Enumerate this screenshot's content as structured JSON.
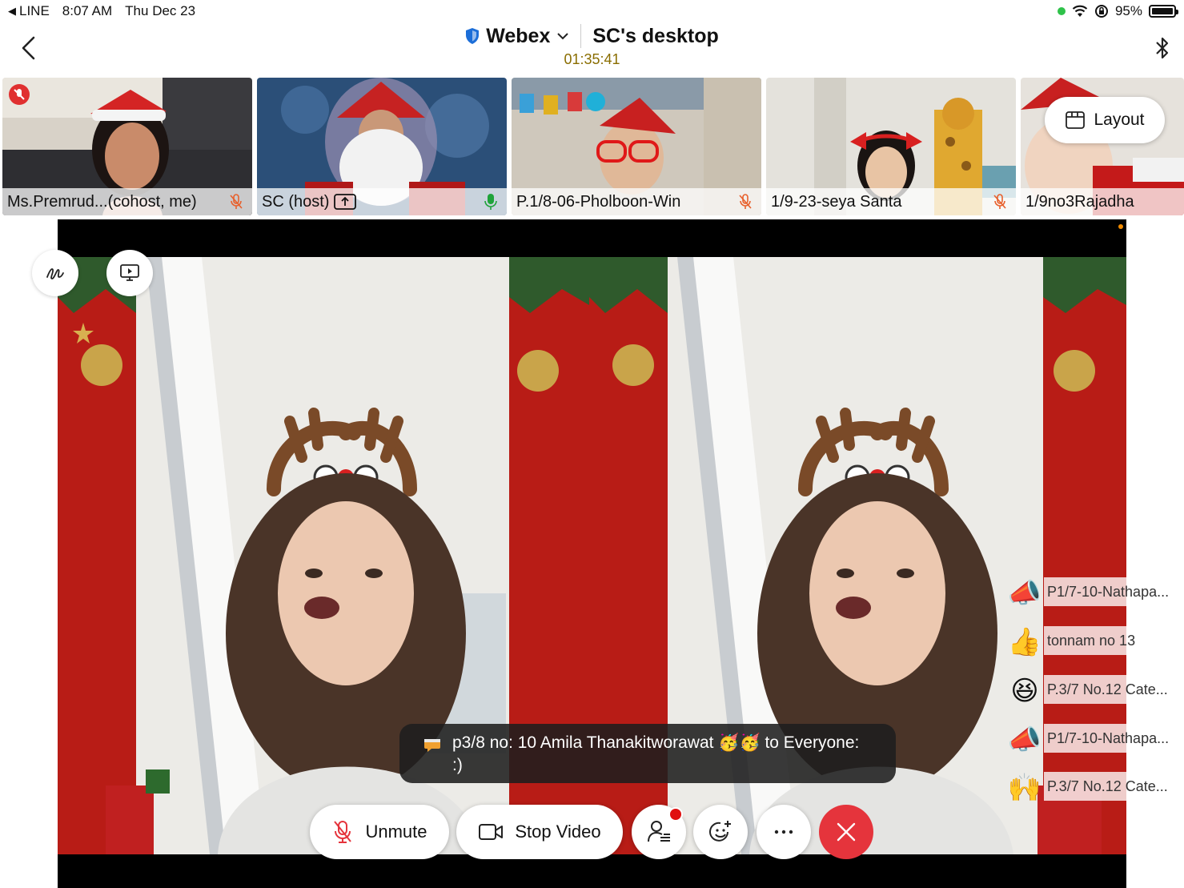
{
  "status_bar": {
    "back_app": "LINE",
    "time": "8:07 AM",
    "date": "Thu Dec 23",
    "battery": "95%",
    "battery_level": 0.95
  },
  "header": {
    "app_name": "Webex",
    "meeting_title": "SC's desktop",
    "timer": "01:35:41"
  },
  "tiles": [
    {
      "name": "Ms.Premrud...(cohost, me)",
      "muted": true
    },
    {
      "name": "SC (host)",
      "muted": false,
      "sharing": true
    },
    {
      "name": "P.1/8-06-Pholboon-Win",
      "muted": true
    },
    {
      "name": "1/9-23-seya Santa",
      "muted": true
    },
    {
      "name": "1/9no3Rajadha",
      "muted": false
    }
  ],
  "layout_button": {
    "label": "Layout"
  },
  "chat_toast": {
    "sender": "p3/8 no: 10 Amila Thanakitworawat 🥳🥳 to Everyone:",
    "message": ":)"
  },
  "controls": {
    "unmute_label": "Unmute",
    "stop_video_label": "Stop Video"
  },
  "reactions": [
    {
      "emoji": "📣",
      "name": "P1/7-10-Nathapa..."
    },
    {
      "emoji": "👍",
      "name": "tonnam no 13"
    },
    {
      "emoji": "😆",
      "name": "P.3/7 No.12 Cate..."
    },
    {
      "emoji": "📣",
      "name": "P1/7-10-Nathapa..."
    },
    {
      "emoji": "🙌",
      "name": "P.3/7 No.12 Cate..."
    }
  ],
  "colors": {
    "end_button": "#e5343c",
    "muted_icon": "#e8602c",
    "mic_active": "#1fa33a",
    "timer": "#8a6d00"
  }
}
